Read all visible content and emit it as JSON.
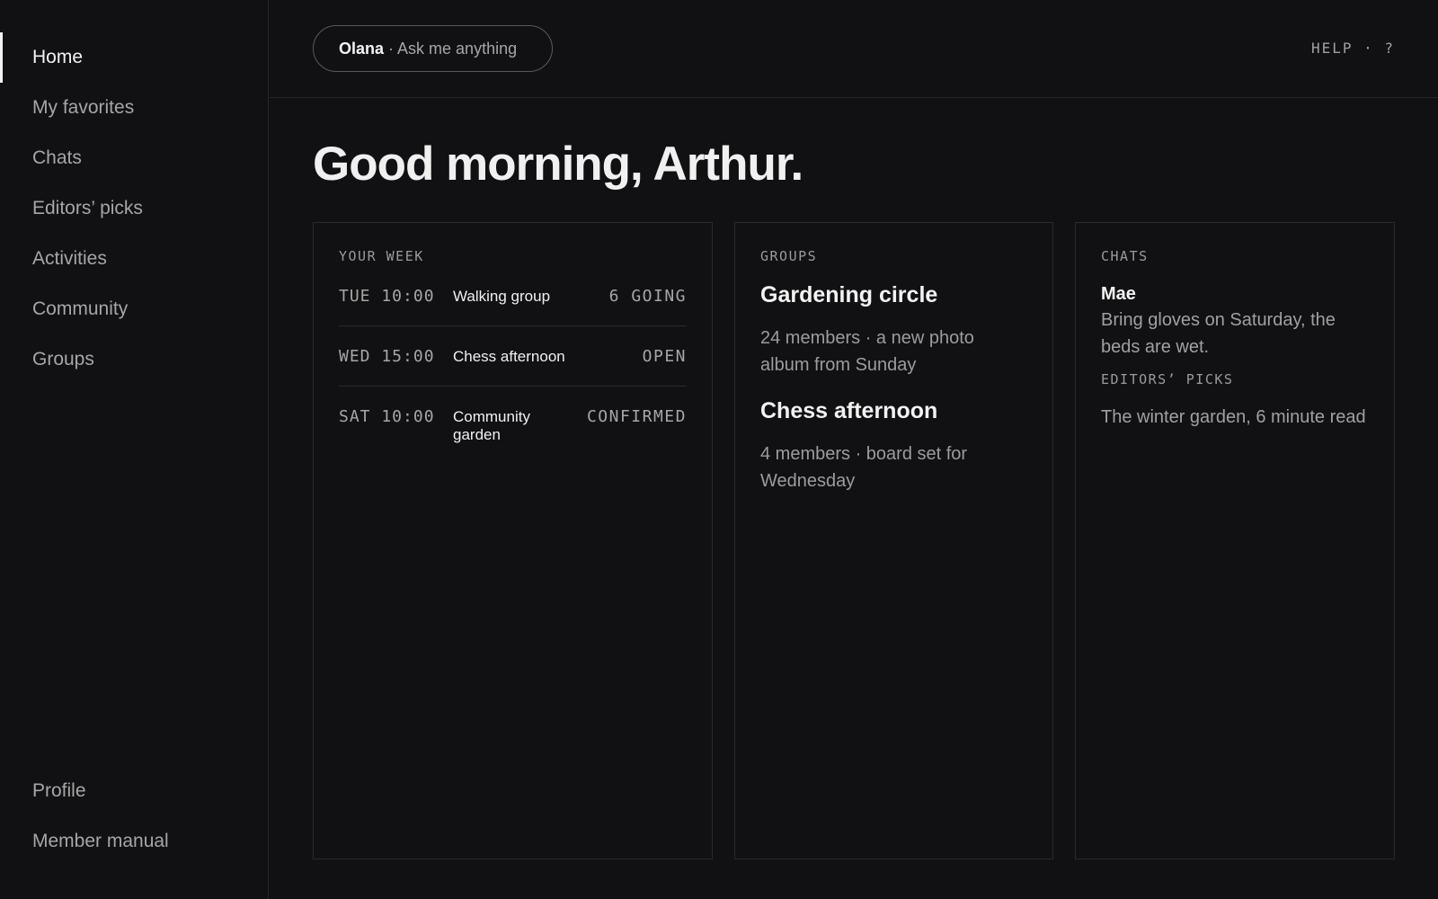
{
  "sidebar": {
    "items": [
      {
        "label": "Home"
      },
      {
        "label": "My favorites"
      },
      {
        "label": "Chats"
      },
      {
        "label": "Editors’ picks"
      },
      {
        "label": "Activities"
      },
      {
        "label": "Community"
      },
      {
        "label": "Groups"
      }
    ],
    "bottom_items": [
      {
        "label": "Profile"
      },
      {
        "label": "Member manual"
      }
    ]
  },
  "topbar": {
    "assistant_name": "Olana",
    "assistant_prompt": " · Ask me anything",
    "help_label": "HELP · ?"
  },
  "greeting": "Good morning, Arthur.",
  "week": {
    "heading": "YOUR WEEK",
    "rows": [
      {
        "time": "TUE 10:00",
        "name": "Walking group",
        "status": "6 GOING"
      },
      {
        "time": "WED 15:00",
        "name": "Chess afternoon",
        "status": "OPEN"
      },
      {
        "time": "SAT 10:00",
        "name": "Community garden",
        "status": "CONFIRMED"
      }
    ]
  },
  "groups": {
    "heading": "GROUPS",
    "items": [
      {
        "title": "Gardening circle",
        "desc": "24 members · a new photo album from Sunday"
      },
      {
        "title": "Chess afternoon",
        "desc": "4 members · board set for Wednesday"
      }
    ]
  },
  "chats": {
    "heading": "CHATS",
    "sender": "Mae",
    "message": "Bring gloves on Saturday, the beds are wet.",
    "picks_heading": "EDITORS’ PICKS",
    "pick": "The winter garden, 6 minute read"
  }
}
